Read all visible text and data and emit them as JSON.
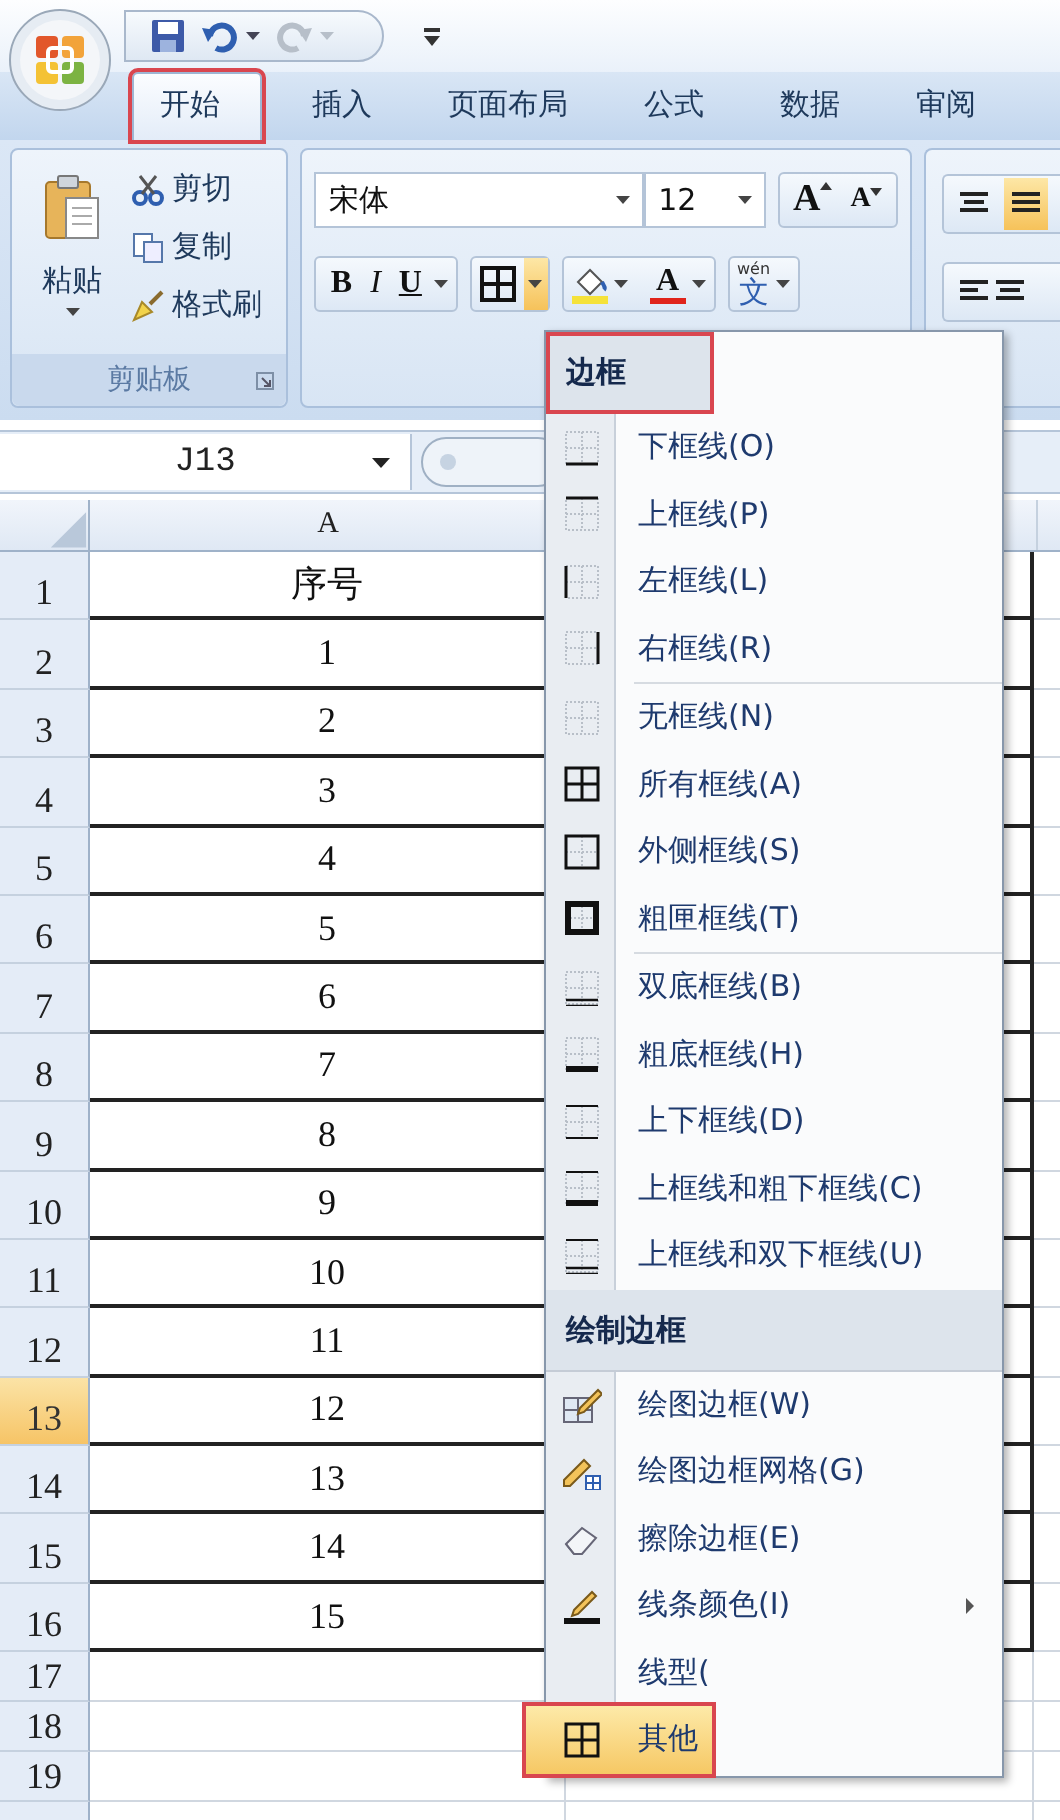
{
  "quick_access": [
    {
      "kind": "save"
    },
    {
      "kind": "undo",
      "dropdown": true
    },
    {
      "kind": "redo",
      "dropdown": true,
      "disabled": true
    },
    {
      "kind": "customize"
    }
  ],
  "tabs": [
    {
      "label": "开始",
      "selected": true,
      "outlined": true
    },
    {
      "label": "插入",
      "selected": false
    },
    {
      "label": "页面布局",
      "selected": false
    },
    {
      "label": "公式",
      "selected": false
    },
    {
      "label": "数据",
      "selected": false
    },
    {
      "label": "审阅",
      "selected": false
    }
  ],
  "clipboard": {
    "paste": "粘贴",
    "cut": "剪切",
    "copy": "复制",
    "format_painter": "格式刷",
    "group_label": "剪贴板"
  },
  "font": {
    "name": "宋体",
    "size": "12",
    "grow": "A",
    "shrink": "A",
    "bold": "B",
    "italic": "I",
    "underline": "U",
    "borders_open": true,
    "font_color": "A",
    "phonetic": "文",
    "phonetic_ruby": "wén"
  },
  "name_box": "J13",
  "sheet": {
    "column_headers": [
      "A"
    ],
    "rows": [
      {
        "number": "1",
        "cell": "序号",
        "selected": false
      },
      {
        "number": "2",
        "cell": "1",
        "selected": false
      },
      {
        "number": "3",
        "cell": "2",
        "selected": false
      },
      {
        "number": "4",
        "cell": "3",
        "selected": false
      },
      {
        "number": "5",
        "cell": "4",
        "selected": false
      },
      {
        "number": "6",
        "cell": "5",
        "selected": false
      },
      {
        "number": "7",
        "cell": "6",
        "selected": false
      },
      {
        "number": "8",
        "cell": "7",
        "selected": false
      },
      {
        "number": "9",
        "cell": "8",
        "selected": false
      },
      {
        "number": "10",
        "cell": "9",
        "selected": false
      },
      {
        "number": "11",
        "cell": "10",
        "selected": false
      },
      {
        "number": "12",
        "cell": "11",
        "selected": false
      },
      {
        "number": "13",
        "cell": "12",
        "selected": true
      },
      {
        "number": "14",
        "cell": "13",
        "selected": false
      },
      {
        "number": "15",
        "cell": "14",
        "selected": false
      },
      {
        "number": "16",
        "cell": "15",
        "selected": false
      },
      {
        "number": "17",
        "selected": false
      },
      {
        "number": "18",
        "selected": false
      },
      {
        "number": "19",
        "selected": false
      }
    ]
  },
  "border_menu": {
    "sections": [
      {
        "header": {
          "text": "边框",
          "outlined": true
        },
        "items": [
          {
            "label": "下框线(O)",
            "selected": false
          },
          {
            "label": "上框线(P)",
            "selected": false
          },
          {
            "label": "左框线(L)",
            "selected": false
          },
          {
            "label": "右框线(R)",
            "selected": false
          }
        ]
      },
      {
        "items": [
          {
            "label": "无框线(N)",
            "selected": false
          },
          {
            "label": "所有框线(A)",
            "selected": false
          },
          {
            "label": "外侧框线(S)",
            "selected": false
          },
          {
            "label": "粗匣框线(T)",
            "selected": false
          }
        ]
      },
      {
        "items": [
          {
            "label": "双底框线(B)",
            "selected": false
          },
          {
            "label": "粗底框线(H)",
            "selected": false
          },
          {
            "label": "上下框线(D)",
            "selected": false
          },
          {
            "label": "上框线和粗下框线(C)",
            "selected": false
          },
          {
            "label": "上框线和双下框线(U)",
            "selected": false
          }
        ]
      },
      {
        "header": {
          "text": "绘制边框"
        },
        "items": [
          {
            "label": "绘图边框(W)",
            "selected": false
          },
          {
            "label": "绘图边框网格(G)",
            "selected": false
          },
          {
            "label": "擦除边框(E)",
            "selected": false
          },
          {
            "label": "线条颜色(I)",
            "selected": false,
            "submenu": true
          },
          {
            "label": "线型(",
            "selected": false
          },
          {
            "label": "其他",
            "selected": true,
            "outlined": true
          }
        ]
      }
    ]
  }
}
